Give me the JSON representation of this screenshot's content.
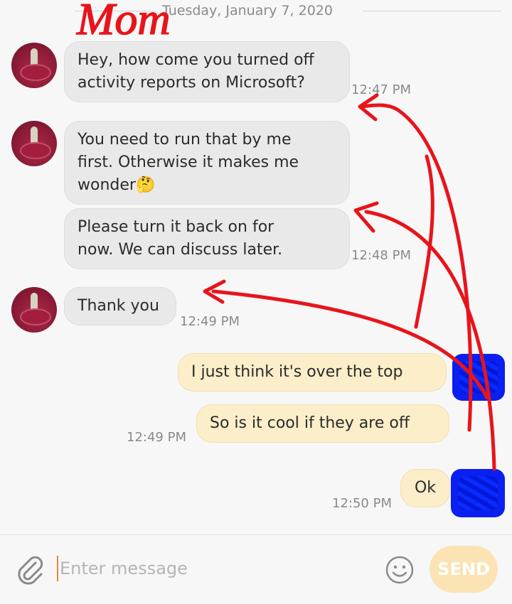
{
  "header": {
    "date": "Tuesday, January 7, 2020",
    "annotation_label": "Mom"
  },
  "messages": [
    {
      "text": "Hey, how come you turned off\nactivity reports on Microsoft?",
      "time": "12:47 PM"
    },
    {
      "text": "You need to run that by me\nfirst. Otherwise it makes me\nwonder🤔"
    },
    {
      "text": "Please turn it back on for\nnow. We can discuss later.",
      "time": "12:48 PM"
    },
    {
      "text": "Thank you",
      "time": "12:49 PM"
    },
    {
      "text": "I just think it's over the top"
    },
    {
      "text": "So is it cool if they are off",
      "time": "12:49 PM"
    },
    {
      "text": "Ok",
      "time": "12:50 PM"
    }
  ],
  "composer": {
    "placeholder": "Enter message",
    "send_label": "SEND"
  },
  "icons": {
    "attach": "paperclip-icon",
    "emoji": "smiley-icon"
  },
  "colors": {
    "incoming_bubble": "#e9e9e9",
    "outgoing_bubble": "#fbeec9",
    "annotation_red": "#e8141b",
    "redaction_blue": "#0a1ff0",
    "send_button": "#fbe3b4"
  }
}
